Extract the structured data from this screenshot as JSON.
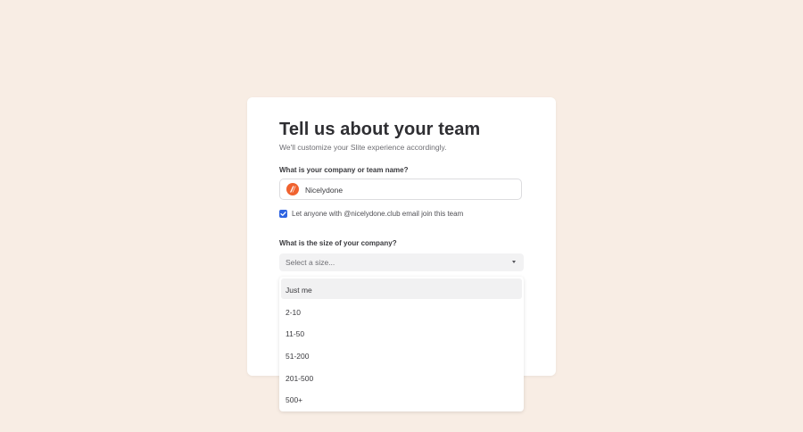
{
  "card": {
    "title": "Tell us about your team",
    "subtitle": "We'll customize your Slite experience accordingly."
  },
  "team_name": {
    "label": "What is your company or team name?",
    "value": "Nicelydone",
    "logo_icon": "nicelydone-logo-icon",
    "logo_color": "#f0622f"
  },
  "join_option": {
    "checked": true,
    "label": "Let anyone with @nicelydone.club email join this team",
    "accent": "#2d63e1"
  },
  "company_size": {
    "label": "What is the size of your company?",
    "selected": "Select a size...",
    "options": [
      "Just me",
      "2-10",
      "11-50",
      "51-200",
      "201-500",
      "500+"
    ],
    "highlighted": "Just me"
  },
  "colors": {
    "background": "#f8ede4",
    "card": "#ffffff"
  }
}
